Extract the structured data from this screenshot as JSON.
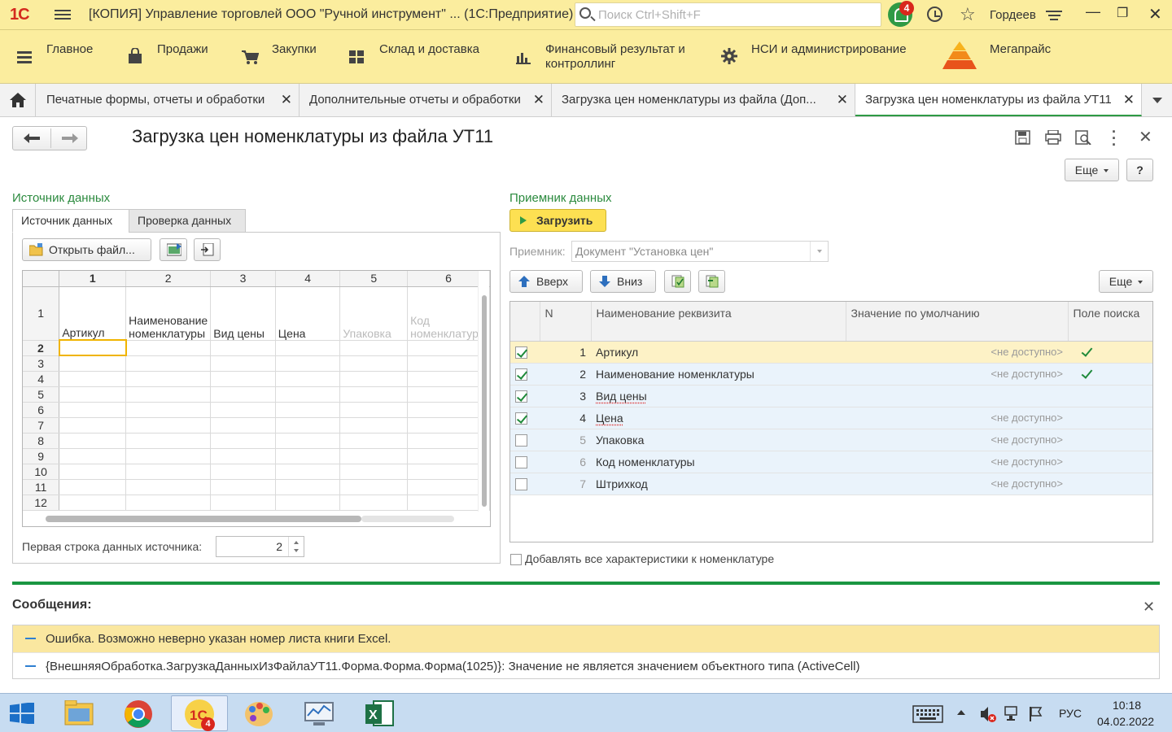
{
  "titlebar": {
    "logo": "1С",
    "title": "[КОПИЯ] Управление торговлей ООО \"Ручной инструмент\" ...  (1С:Предприятие)",
    "search_placeholder": "Поиск Ctrl+Shift+F",
    "notifications_count": "4",
    "user": "Гордеев"
  },
  "sections": [
    {
      "label": "Главное",
      "icon": "menu-icon"
    },
    {
      "label": "Продажи",
      "icon": "shopping-bag-icon"
    },
    {
      "label": "Закупки",
      "icon": "cart-icon"
    },
    {
      "label": "Склад и доставка",
      "icon": "warehouse-icon"
    },
    {
      "label": "Финансовый результат и контроллинг",
      "icon": "chart-icon"
    },
    {
      "label": "НСИ и администрирование",
      "icon": "gear-icon"
    },
    {
      "label": "Мегапрайс",
      "icon": "pyramid-icon"
    }
  ],
  "tabs": [
    {
      "label": "Печатные формы, отчеты и обработки"
    },
    {
      "label": "Дополнительные отчеты и обработки"
    },
    {
      "label": "Загрузка цен номенклатуры из файла (Доп..."
    },
    {
      "label": "Загрузка цен номенклатуры из файла УТ11"
    }
  ],
  "form": {
    "title": "Загрузка цен номенклатуры из файла УТ11",
    "more_label": "Еще",
    "help_label": "?"
  },
  "source": {
    "group_title": "Источник данных",
    "tabs": [
      "Источник данных",
      "Проверка данных"
    ],
    "open_file_label": "Открыть файл...",
    "col_numbers": [
      "1",
      "2",
      "3",
      "4",
      "5",
      "6"
    ],
    "header_row_number": "1",
    "header_cells": [
      "Артикул",
      "Наименование номенклатуры",
      "Вид цены",
      "Цена",
      "Упаковка",
      "Код номенклатуры"
    ],
    "row_numbers": [
      "2",
      "3",
      "4",
      "5",
      "6",
      "7",
      "8",
      "9",
      "10",
      "11",
      "12"
    ],
    "first_row_label": "Первая строка данных источника:",
    "first_row_value": "2"
  },
  "receiver": {
    "group_title": "Приемник данных",
    "load_label": "Загрузить",
    "receiver_label": "Приемник:",
    "receiver_value": "Документ \"Установка цен\"",
    "up_label": "Вверх",
    "down_label": "Вниз",
    "more_label": "Еще",
    "columns": [
      "N",
      "Наименование реквизита",
      "Значение по умолчанию",
      "Поле поиска"
    ],
    "rows": [
      {
        "checked": true,
        "n": "1",
        "name": "Артикул",
        "default": "<не доступно>",
        "search": true
      },
      {
        "checked": true,
        "n": "2",
        "name": "Наименование номенклатуры",
        "default": "<не доступно>",
        "search": true
      },
      {
        "checked": true,
        "n": "3",
        "name": "Вид цены",
        "default": "",
        "search": false
      },
      {
        "checked": true,
        "n": "4",
        "name": "Цена",
        "default": "<не доступно>",
        "search": false
      },
      {
        "checked": false,
        "n": "5",
        "name": "Упаковка",
        "default": "<не доступно>",
        "search": false
      },
      {
        "checked": false,
        "n": "6",
        "name": "Код номенклатуры",
        "default": "<не доступно>",
        "search": false
      },
      {
        "checked": false,
        "n": "7",
        "name": "Штрихкод",
        "default": "<не доступно>",
        "search": false
      }
    ],
    "add_characteristics_label": "Добавлять все характеристики к номенклатуре"
  },
  "messages": {
    "title": "Сообщения:",
    "items": [
      "Ошибка. Возможно неверно указан номер листа книги Excel.",
      "{ВнешняяОбработка.ЗагрузкаДанныхИзФайлаУТ11.Форма.Форма.Форма(1025)}: Значение не является значением объектного типа (ActiveCell)"
    ]
  },
  "taskbar": {
    "lang": "РУС",
    "time": "10:18",
    "date": "04.02.2022",
    "onec_badge": "4"
  }
}
